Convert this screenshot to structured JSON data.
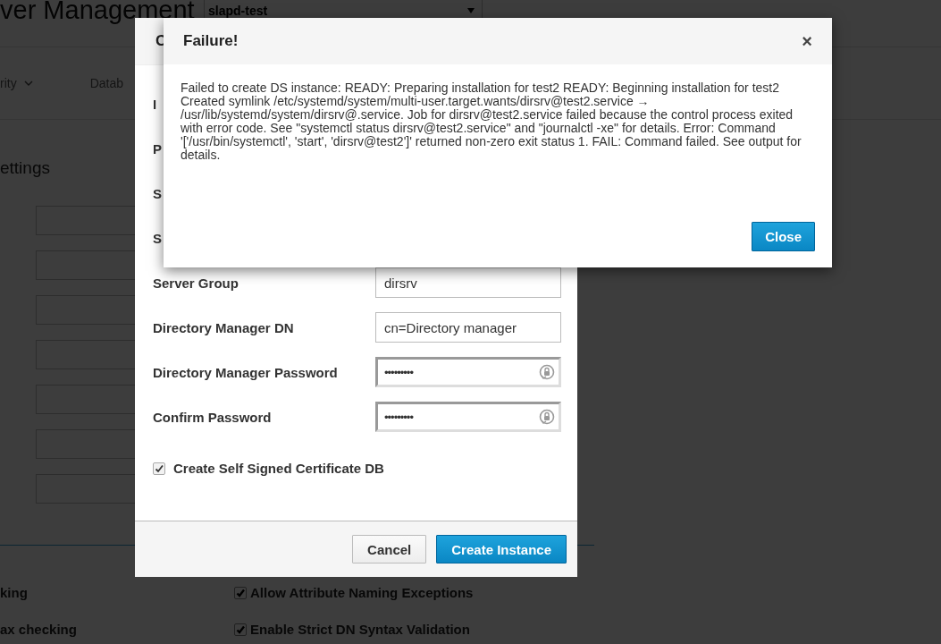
{
  "background_page": {
    "title": "ver Management",
    "instance_select": {
      "value": "slapd-test"
    },
    "nav_items": [
      {
        "label": "rity",
        "dropdown": true
      },
      {
        "label": "Datab",
        "dropdown": false
      }
    ],
    "section_title": "ettings",
    "settings_fields": [
      {
        "kind": "input"
      },
      {
        "kind": "input"
      },
      {
        "kind": "input"
      },
      {
        "kind": "input"
      },
      {
        "kind": "input"
      },
      {
        "kind": "input"
      },
      {
        "kind": "input"
      }
    ],
    "options": [
      {
        "label": "king",
        "kind": "text"
      },
      {
        "label": "Allow Attribute Naming Exceptions",
        "kind": "checkbox",
        "checked": true
      },
      {
        "label": "ax checking",
        "kind": "text"
      },
      {
        "label": "Enable Strict DN Syntax Validation",
        "kind": "checkbox",
        "checked": true
      }
    ]
  },
  "create_dialog": {
    "title": "C",
    "fields": [
      {
        "label": "I",
        "kind": "label"
      },
      {
        "label": "P",
        "kind": "label"
      },
      {
        "label": "S",
        "kind": "label"
      },
      {
        "label": "S",
        "kind": "label"
      },
      {
        "label": "Server Group",
        "kind": "text",
        "value": "dirsrv"
      },
      {
        "label": "Directory Manager DN",
        "kind": "text",
        "value": "cn=Directory manager"
      },
      {
        "label": "Directory Manager Password",
        "kind": "password",
        "value": "•••••••••"
      },
      {
        "label": "Confirm Password",
        "kind": "password",
        "value": "•••••••••"
      }
    ],
    "checkbox": {
      "label": "Create Self Signed Certificate DB",
      "checked": true
    },
    "buttons": [
      {
        "label": "Cancel",
        "kind": "default"
      },
      {
        "label": "Create Instance",
        "kind": "primary"
      }
    ]
  },
  "failure_dialog": {
    "title": "Failure!",
    "close_glyph": "×",
    "message": "Failed to create DS instance: READY: Preparing installation for test2 READY: Beginning installation for test2 Created symlink /etc/systemd/system/multi-user.target.wants/dirsrv@test2.service → /usr/lib/systemd/system/dirsrv@.service. Job for dirsrv@test2.service failed because the control process exited with error code. See \"systemctl status dirsrv@test2.service\" and \"journalctl -xe\" for details. Error: Command '['/usr/bin/systemctl', 'start', 'dirsrv@test2']' returned non-zero exit status 1. FAIL: Command failed. See output for details.",
    "buttons": [
      {
        "label": "Close",
        "kind": "primary"
      }
    ]
  }
}
